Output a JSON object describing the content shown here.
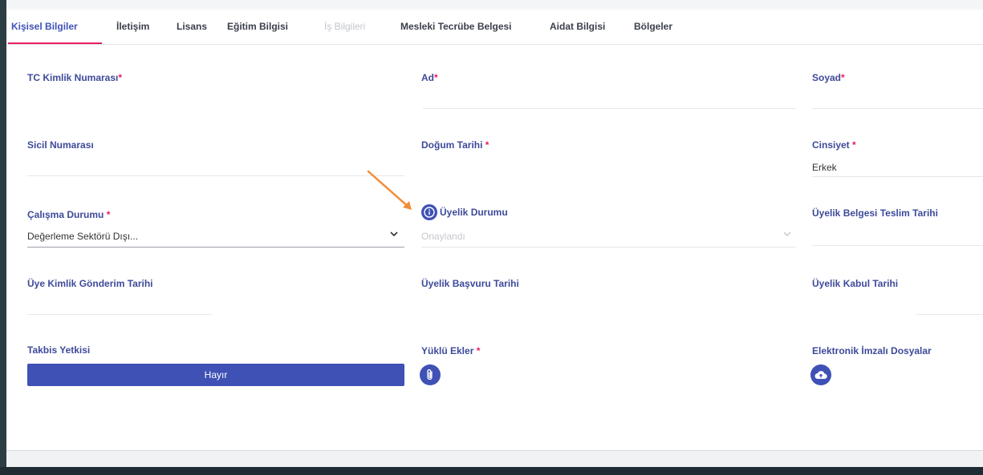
{
  "tabs": [
    {
      "label": "Kişisel Bilgiler",
      "state": "active"
    },
    {
      "label": "İletişim",
      "state": "normal"
    },
    {
      "label": "Lisans",
      "state": "normal"
    },
    {
      "label": "Eğitim Bilgisi",
      "state": "normal"
    },
    {
      "label": "İş Bilgileri",
      "state": "disabled"
    },
    {
      "label": "Mesleki Tecrübe Belgesi",
      "state": "normal"
    },
    {
      "label": "Aidat Bilgisi",
      "state": "normal"
    },
    {
      "label": "Bölgeler",
      "state": "normal"
    }
  ],
  "fields": {
    "tc": {
      "label": "TC Kimlik Numarası",
      "required": "*",
      "value": ""
    },
    "ad": {
      "label": "Ad",
      "required": "*",
      "value": ""
    },
    "soyad": {
      "label": "Soyad",
      "required": "*",
      "value": ""
    },
    "sicil": {
      "label": "Sicil Numarası",
      "value": ""
    },
    "dogum": {
      "label": "Doğum Tarihi ",
      "required": "*",
      "value": ""
    },
    "cinsiyet": {
      "label": "Cinsiyet ",
      "required": "*",
      "value": "Erkek"
    },
    "calisma": {
      "label": "Çalışma Durumu ",
      "required": "*",
      "value": "Değerleme Sektörü Dışı..."
    },
    "uyelik_durumu": {
      "label": "Üyelik Durumu",
      "value": "Onaylandı"
    },
    "uyelik_belgesi": {
      "label": "Üyelik Belgesi Teslim Tarihi",
      "value": ""
    },
    "uye_kimlik": {
      "label": "Üye Kimlik Gönderim Tarihi",
      "value": ""
    },
    "uyelik_basvuru": {
      "label": "Üyelik Başvuru Tarihi",
      "value": ""
    },
    "uyelik_kabul": {
      "label": "Üyelik Kabul Tarihi",
      "value": ""
    },
    "takbis": {
      "label": "Takbis Yetkisi",
      "value": "Hayır"
    },
    "yuklu_ekler": {
      "label": "Yüklü Ekler ",
      "required": "*"
    },
    "elektronik": {
      "label": "Elektronik İmzalı Dosyalar"
    }
  },
  "icons": {
    "info": "info-icon",
    "attachment": "paperclip-icon",
    "upload": "cloud-upload-icon",
    "annotation": "orange-arrow-icon"
  },
  "colors": {
    "primary": "#3f51b5",
    "accent": "#e91e63",
    "label": "#3d4a9a",
    "annotation_arrow": "#f28c38"
  }
}
